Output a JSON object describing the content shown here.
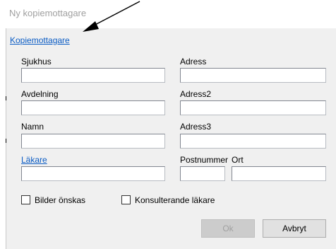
{
  "window": {
    "title": "Ny kopiemottagare"
  },
  "header_link": "Kopiemottagare",
  "labels": {
    "sjukhus": "Sjukhus",
    "avdelning": "Avdelning",
    "namn": "Namn",
    "lakare": "Läkare",
    "adress": "Adress",
    "adress2": "Adress2",
    "adress3": "Adress3",
    "postnummer": "Postnummer",
    "ort": "Ort"
  },
  "fields": {
    "sjukhus": "",
    "avdelning": "",
    "namn": "",
    "lakare": "",
    "adress": "",
    "adress2": "",
    "adress3": "",
    "postnummer": "",
    "ort": ""
  },
  "checkboxes": {
    "bilder": {
      "label": "Bilder önskas",
      "checked": false
    },
    "konsulterande": {
      "label": "Konsulterande läkare",
      "checked": false
    }
  },
  "buttons": {
    "ok": {
      "label": "Ok",
      "enabled": false
    },
    "cancel": {
      "label": "Avbryt",
      "enabled": true
    }
  },
  "colors": {
    "link": "#0b5cc4",
    "dialog_background": "#f0f0f0",
    "title_text": "#a0a0a0"
  },
  "icons": {
    "annotation": "arrow-pointer-icon"
  }
}
